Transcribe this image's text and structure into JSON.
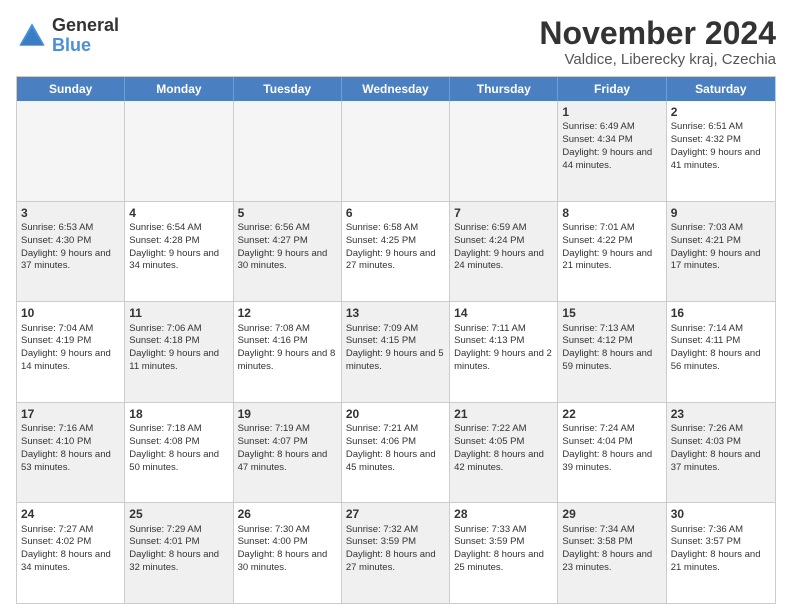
{
  "logo": {
    "line1": "General",
    "line2": "Blue"
  },
  "title": "November 2024",
  "location": "Valdice, Liberecky kraj, Czechia",
  "days_header": [
    "Sunday",
    "Monday",
    "Tuesday",
    "Wednesday",
    "Thursday",
    "Friday",
    "Saturday"
  ],
  "weeks": [
    [
      {
        "day": "",
        "info": "",
        "empty": true
      },
      {
        "day": "",
        "info": "",
        "empty": true
      },
      {
        "day": "",
        "info": "",
        "empty": true
      },
      {
        "day": "",
        "info": "",
        "empty": true
      },
      {
        "day": "",
        "info": "",
        "empty": true
      },
      {
        "day": "1",
        "info": "Sunrise: 6:49 AM\nSunset: 4:34 PM\nDaylight: 9 hours and 44 minutes.",
        "empty": false,
        "shaded": true
      },
      {
        "day": "2",
        "info": "Sunrise: 6:51 AM\nSunset: 4:32 PM\nDaylight: 9 hours and 41 minutes.",
        "empty": false,
        "shaded": false
      }
    ],
    [
      {
        "day": "3",
        "info": "Sunrise: 6:53 AM\nSunset: 4:30 PM\nDaylight: 9 hours and 37 minutes.",
        "empty": false,
        "shaded": true
      },
      {
        "day": "4",
        "info": "Sunrise: 6:54 AM\nSunset: 4:28 PM\nDaylight: 9 hours and 34 minutes.",
        "empty": false,
        "shaded": false
      },
      {
        "day": "5",
        "info": "Sunrise: 6:56 AM\nSunset: 4:27 PM\nDaylight: 9 hours and 30 minutes.",
        "empty": false,
        "shaded": true
      },
      {
        "day": "6",
        "info": "Sunrise: 6:58 AM\nSunset: 4:25 PM\nDaylight: 9 hours and 27 minutes.",
        "empty": false,
        "shaded": false
      },
      {
        "day": "7",
        "info": "Sunrise: 6:59 AM\nSunset: 4:24 PM\nDaylight: 9 hours and 24 minutes.",
        "empty": false,
        "shaded": true
      },
      {
        "day": "8",
        "info": "Sunrise: 7:01 AM\nSunset: 4:22 PM\nDaylight: 9 hours and 21 minutes.",
        "empty": false,
        "shaded": false
      },
      {
        "day": "9",
        "info": "Sunrise: 7:03 AM\nSunset: 4:21 PM\nDaylight: 9 hours and 17 minutes.",
        "empty": false,
        "shaded": true
      }
    ],
    [
      {
        "day": "10",
        "info": "Sunrise: 7:04 AM\nSunset: 4:19 PM\nDaylight: 9 hours and 14 minutes.",
        "empty": false,
        "shaded": false
      },
      {
        "day": "11",
        "info": "Sunrise: 7:06 AM\nSunset: 4:18 PM\nDaylight: 9 hours and 11 minutes.",
        "empty": false,
        "shaded": true
      },
      {
        "day": "12",
        "info": "Sunrise: 7:08 AM\nSunset: 4:16 PM\nDaylight: 9 hours and 8 minutes.",
        "empty": false,
        "shaded": false
      },
      {
        "day": "13",
        "info": "Sunrise: 7:09 AM\nSunset: 4:15 PM\nDaylight: 9 hours and 5 minutes.",
        "empty": false,
        "shaded": true
      },
      {
        "day": "14",
        "info": "Sunrise: 7:11 AM\nSunset: 4:13 PM\nDaylight: 9 hours and 2 minutes.",
        "empty": false,
        "shaded": false
      },
      {
        "day": "15",
        "info": "Sunrise: 7:13 AM\nSunset: 4:12 PM\nDaylight: 8 hours and 59 minutes.",
        "empty": false,
        "shaded": true
      },
      {
        "day": "16",
        "info": "Sunrise: 7:14 AM\nSunset: 4:11 PM\nDaylight: 8 hours and 56 minutes.",
        "empty": false,
        "shaded": false
      }
    ],
    [
      {
        "day": "17",
        "info": "Sunrise: 7:16 AM\nSunset: 4:10 PM\nDaylight: 8 hours and 53 minutes.",
        "empty": false,
        "shaded": true
      },
      {
        "day": "18",
        "info": "Sunrise: 7:18 AM\nSunset: 4:08 PM\nDaylight: 8 hours and 50 minutes.",
        "empty": false,
        "shaded": false
      },
      {
        "day": "19",
        "info": "Sunrise: 7:19 AM\nSunset: 4:07 PM\nDaylight: 8 hours and 47 minutes.",
        "empty": false,
        "shaded": true
      },
      {
        "day": "20",
        "info": "Sunrise: 7:21 AM\nSunset: 4:06 PM\nDaylight: 8 hours and 45 minutes.",
        "empty": false,
        "shaded": false
      },
      {
        "day": "21",
        "info": "Sunrise: 7:22 AM\nSunset: 4:05 PM\nDaylight: 8 hours and 42 minutes.",
        "empty": false,
        "shaded": true
      },
      {
        "day": "22",
        "info": "Sunrise: 7:24 AM\nSunset: 4:04 PM\nDaylight: 8 hours and 39 minutes.",
        "empty": false,
        "shaded": false
      },
      {
        "day": "23",
        "info": "Sunrise: 7:26 AM\nSunset: 4:03 PM\nDaylight: 8 hours and 37 minutes.",
        "empty": false,
        "shaded": true
      }
    ],
    [
      {
        "day": "24",
        "info": "Sunrise: 7:27 AM\nSunset: 4:02 PM\nDaylight: 8 hours and 34 minutes.",
        "empty": false,
        "shaded": false
      },
      {
        "day": "25",
        "info": "Sunrise: 7:29 AM\nSunset: 4:01 PM\nDaylight: 8 hours and 32 minutes.",
        "empty": false,
        "shaded": true
      },
      {
        "day": "26",
        "info": "Sunrise: 7:30 AM\nSunset: 4:00 PM\nDaylight: 8 hours and 30 minutes.",
        "empty": false,
        "shaded": false
      },
      {
        "day": "27",
        "info": "Sunrise: 7:32 AM\nSunset: 3:59 PM\nDaylight: 8 hours and 27 minutes.",
        "empty": false,
        "shaded": true
      },
      {
        "day": "28",
        "info": "Sunrise: 7:33 AM\nSunset: 3:59 PM\nDaylight: 8 hours and 25 minutes.",
        "empty": false,
        "shaded": false
      },
      {
        "day": "29",
        "info": "Sunrise: 7:34 AM\nSunset: 3:58 PM\nDaylight: 8 hours and 23 minutes.",
        "empty": false,
        "shaded": true
      },
      {
        "day": "30",
        "info": "Sunrise: 7:36 AM\nSunset: 3:57 PM\nDaylight: 8 hours and 21 minutes.",
        "empty": false,
        "shaded": false
      }
    ]
  ]
}
